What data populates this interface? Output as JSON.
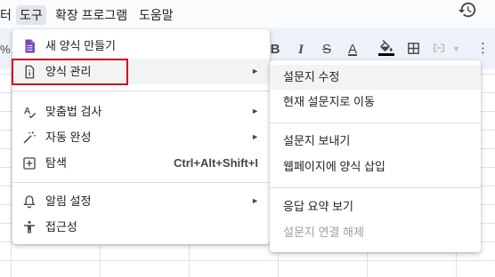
{
  "menubar": {
    "items": [
      {
        "label": "터",
        "active": false
      },
      {
        "label": "도구",
        "active": true
      },
      {
        "label": "확장 프로그램",
        "active": false
      },
      {
        "label": "도움말",
        "active": false
      }
    ]
  },
  "toolbar": {
    "zoom_partial": "%",
    "bold": "B",
    "italic": "I",
    "strike": "S",
    "text_color": "A"
  },
  "tools_menu": {
    "items": [
      {
        "label": "새 양식 만들기",
        "icon": "forms-icon"
      },
      {
        "label": "양식 관리",
        "icon": "form-doc-icon",
        "has_submenu": true,
        "highlighted": true
      },
      {
        "label": "맞춤법 검사",
        "icon": "spellcheck-icon",
        "has_submenu": true
      },
      {
        "label": "자동 완성",
        "icon": "magic-wand-icon",
        "has_submenu": true
      },
      {
        "label": "탐색",
        "icon": "explore-icon",
        "shortcut": "Ctrl+Alt+Shift+I"
      },
      {
        "label": "알림 설정",
        "icon": "bell-icon",
        "has_submenu": true
      },
      {
        "label": "접근성",
        "icon": "accessibility-icon"
      }
    ],
    "submenu_arrow": "►"
  },
  "form_submenu": {
    "items": [
      {
        "label": "설문지 수정",
        "hover": true
      },
      {
        "label": "현재 설문지로 이동"
      },
      {
        "label": "설문지 보내기"
      },
      {
        "label": "웹페이지에 양식 삽입"
      },
      {
        "label": "응답 요약 보기"
      },
      {
        "label": "설문지 연결 해제",
        "disabled": true
      }
    ]
  },
  "colors": {
    "highlight_border": "#d0021b",
    "forms_purple": "#7248b9",
    "menubar_active": "#e2e6eb"
  }
}
